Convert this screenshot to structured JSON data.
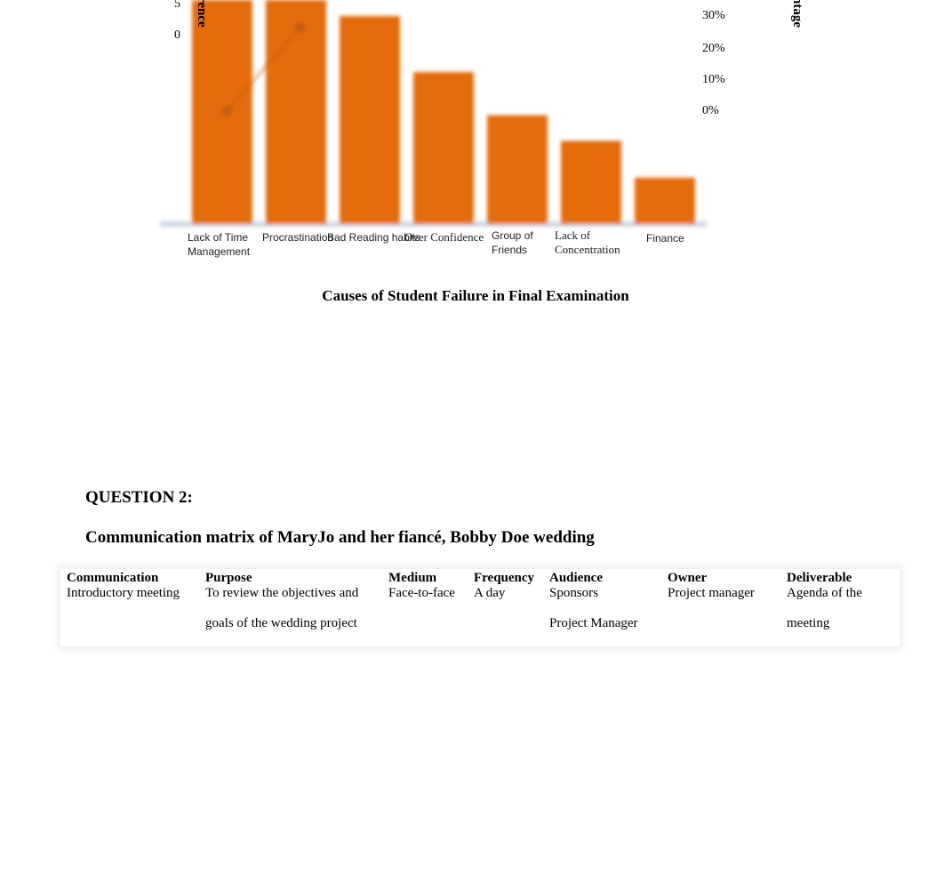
{
  "chart_data": {
    "type": "bar",
    "title": "Causes of Student Failure in Final Examination",
    "ylabel_left_visible": "rence",
    "ylabel_right_visible": "ntage",
    "left_ticks_visible": [
      "5",
      "0"
    ],
    "right_ticks": [
      "30%",
      "20%",
      "10%",
      "0%"
    ],
    "categories": [
      "Lack of Time Management",
      "Procrastination",
      "Bad Reading habits",
      "Over Confidence",
      "Group of Friends",
      "Lack of Concentration",
      "Finance"
    ],
    "values": [
      14,
      14,
      13,
      9.5,
      6.8,
      5.2,
      2.9
    ],
    "bar_color": "#e46c0a",
    "line_series": {
      "type": "line",
      "values": [
        0,
        27
      ]
    }
  },
  "question": "QUESTION 2:",
  "matrix_title": "Communication matrix of MaryJo and her fiancé, Bobby Doe wedding",
  "table": {
    "headers": [
      "Communication",
      "Purpose",
      "Medium",
      "Frequency",
      "Audience",
      "Owner",
      "Deliverable"
    ],
    "row": [
      [
        "Introductory meeting",
        ""
      ],
      [
        "To review the objectives and",
        "goals of the wedding project"
      ],
      [
        "Face-to-face",
        ""
      ],
      [
        "A day",
        ""
      ],
      [
        "Sponsors",
        "Project Manager"
      ],
      [
        "Project manager",
        ""
      ],
      [
        "Agenda of the",
        "meeting"
      ]
    ]
  }
}
